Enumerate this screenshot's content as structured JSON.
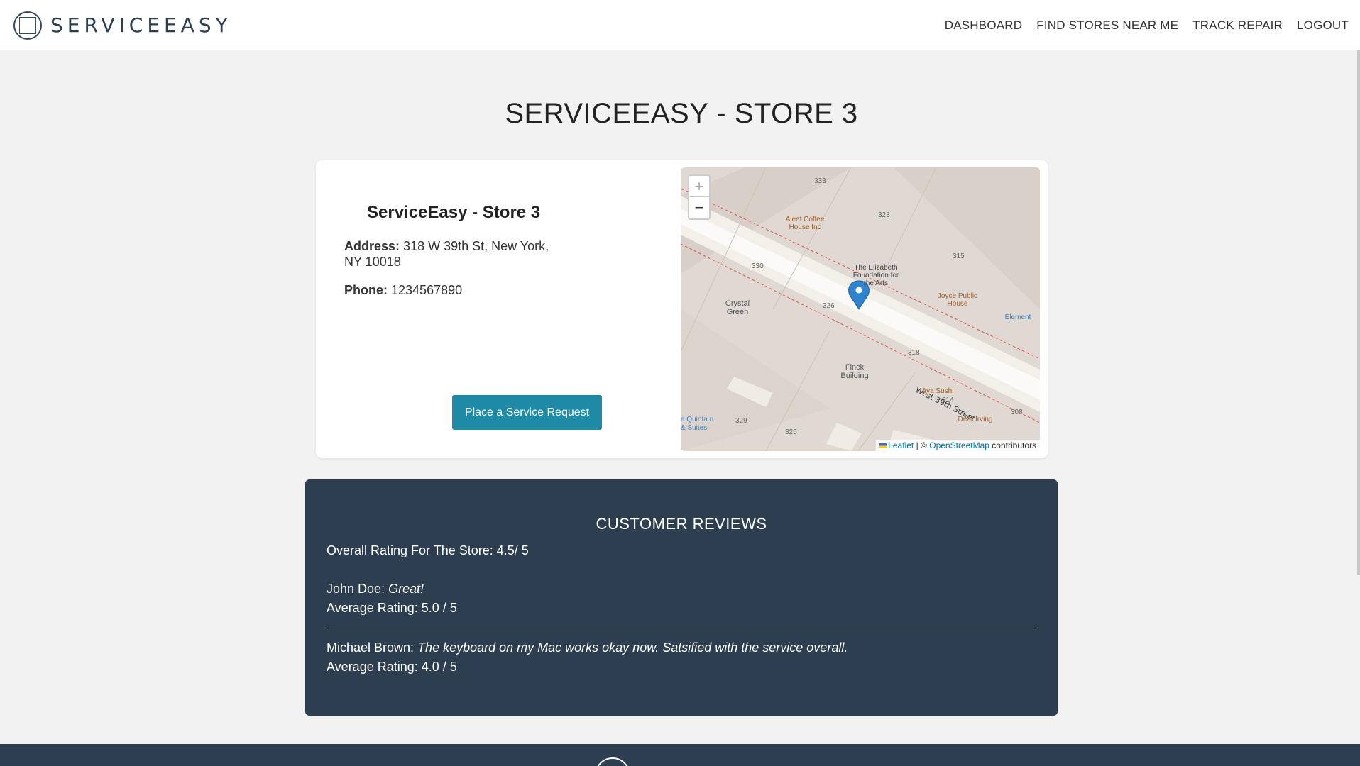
{
  "navbar": {
    "brand_text": "SERVICEEASY",
    "links": [
      "DASHBOARD",
      "FIND STORES NEAR ME",
      "TRACK REPAIR",
      "LOGOUT"
    ]
  },
  "page_title": "SERVICEEASY - STORE 3",
  "store": {
    "name": "ServiceEasy - Store 3",
    "address_label": "Address:",
    "address": "318 W 39th St, New York, NY 10018",
    "phone_label": "Phone:",
    "phone": "1234567890",
    "service_button": "Place a Service Request"
  },
  "map": {
    "zoom_in": "+",
    "zoom_out": "−",
    "street": "West 39th Street",
    "places": {
      "aleef": "Aleef Coffee House Inc",
      "elizabeth": "The Elizabeth Foundation for the Arts",
      "joyce": "Joyce Public House",
      "crystal": "Crystal Green",
      "finck": "Finck Building",
      "aya": "Aya Sushi",
      "dear": "Dear Irving",
      "element": "Element",
      "laquinta": "a Quinta n & Suites"
    },
    "numbers": {
      "n333": "333",
      "n323": "323",
      "n315": "315",
      "n330": "330",
      "n326": "326",
      "n318": "318",
      "n314": "314",
      "n308": "308",
      "n329": "329",
      "n325": "325"
    },
    "attribution_leaflet": "Leaflet",
    "attribution_sep": "| ©",
    "attribution_osm": "OpenStreetMap",
    "attribution_contrib": "contributors"
  },
  "reviews": {
    "title": "CUSTOMER REVIEWS",
    "overall_label": "Overall Rating For The Store:",
    "overall_value": "4.5/ 5",
    "items": [
      {
        "author": "John Doe",
        "comment": "Great!",
        "rating_text": "Average Rating: 5.0 / 5"
      },
      {
        "author": "Michael Brown",
        "comment": "The keyboard on my Mac works okay now. Satsified with the service overall.",
        "rating_text": "Average Rating: 4.0 / 5"
      }
    ]
  }
}
